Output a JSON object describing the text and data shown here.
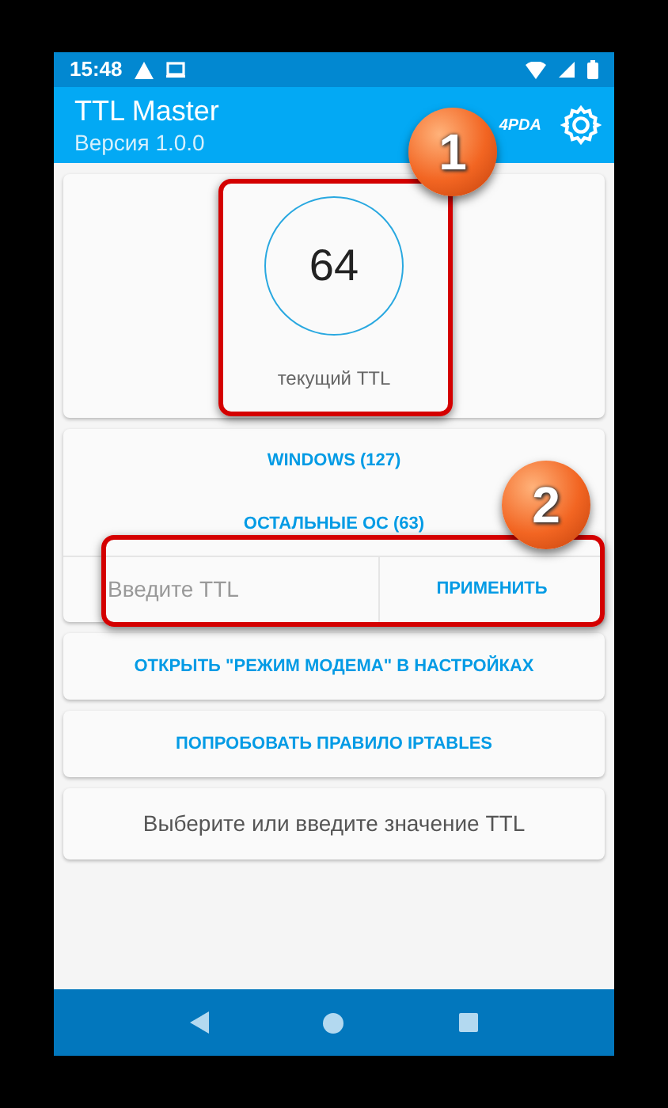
{
  "status_bar": {
    "time": "15:48"
  },
  "app_bar": {
    "title": "TTL Master",
    "subtitle": "Версия 1.0.0",
    "logo": "4PDA"
  },
  "ttl_card": {
    "value": "64",
    "caption": "текущий TTL"
  },
  "presets": [
    "WINDOWS (127)",
    "ОСТАЛЬНЫЕ ОС (63)"
  ],
  "ttl_input": {
    "placeholder": "Введите TTL",
    "button": "ПРИМЕНИТЬ"
  },
  "actions": [
    "ОТКРЫТЬ \"РЕЖИМ МОДЕМА\" В НАСТРОЙКАХ",
    "ПОПРОБОВАТЬ ПРАВИЛО IPTABLES"
  ],
  "hint": "Выберите или введите значение TTL",
  "callouts": [
    {
      "number": "1"
    },
    {
      "number": "2"
    }
  ]
}
